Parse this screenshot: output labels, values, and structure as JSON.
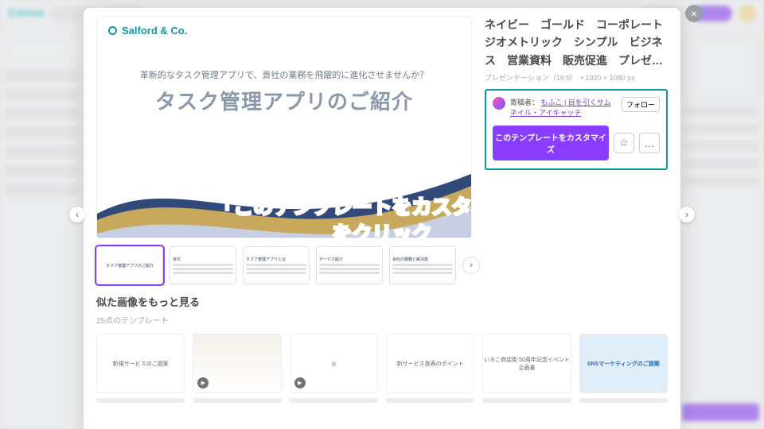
{
  "bg": {
    "logo": "Canva"
  },
  "modal": {
    "brand": "Salford & Co.",
    "slide_subtitle": "革新的なタスク管理アプリで、貴社の業務を飛躍的に進化させませんか？",
    "slide_title": "タスク管理アプリのご紹介",
    "tags": "ネイビー　ゴールド　コーポレート　ジオメトリック　シンプル　ビジネス　営業資料　販売促進　プレゼ…",
    "meta": "プレゼンテーション（16:9）　• 1920 × 1080 px",
    "author_label": "寄稿者：",
    "author_link": "もふこ | 目を引くサムネイル・アイキャッチ",
    "follow": "フォロー",
    "cta": "このテンプレートをカスタマイズ",
    "star": "☆",
    "more": "…",
    "thumbs": [
      {
        "label": "タスク管理アプリのご紹介",
        "active": true
      },
      {
        "label": "目次"
      },
      {
        "label": "タスク管理アプリとは"
      },
      {
        "label": "サービス紹介"
      },
      {
        "label": "会社の課題と解決案"
      }
    ],
    "next": "›",
    "similar_title": "似た画像をもっと見る",
    "similar_count": "25点のテンプレート",
    "cards": [
      {
        "t": "新規サービスのご提案",
        "cls": ""
      },
      {
        "t": "",
        "cls": "v",
        "play": true
      },
      {
        "t": "◎",
        "cls": "",
        "play": true
      },
      {
        "t": "新サービス発表のポイント",
        "cls": "brand"
      },
      {
        "t": "いろこ商店街 50周年記念イベント 企画書",
        "cls": ""
      },
      {
        "t": "SNSマーケティングのご提案",
        "cls": "blue"
      }
    ]
  },
  "annotation": {
    "line1": "「このテンプレートをカスタマイズ」",
    "line2": "をクリック"
  },
  "chev": {
    "l": "‹",
    "r": "›"
  },
  "close": "×"
}
